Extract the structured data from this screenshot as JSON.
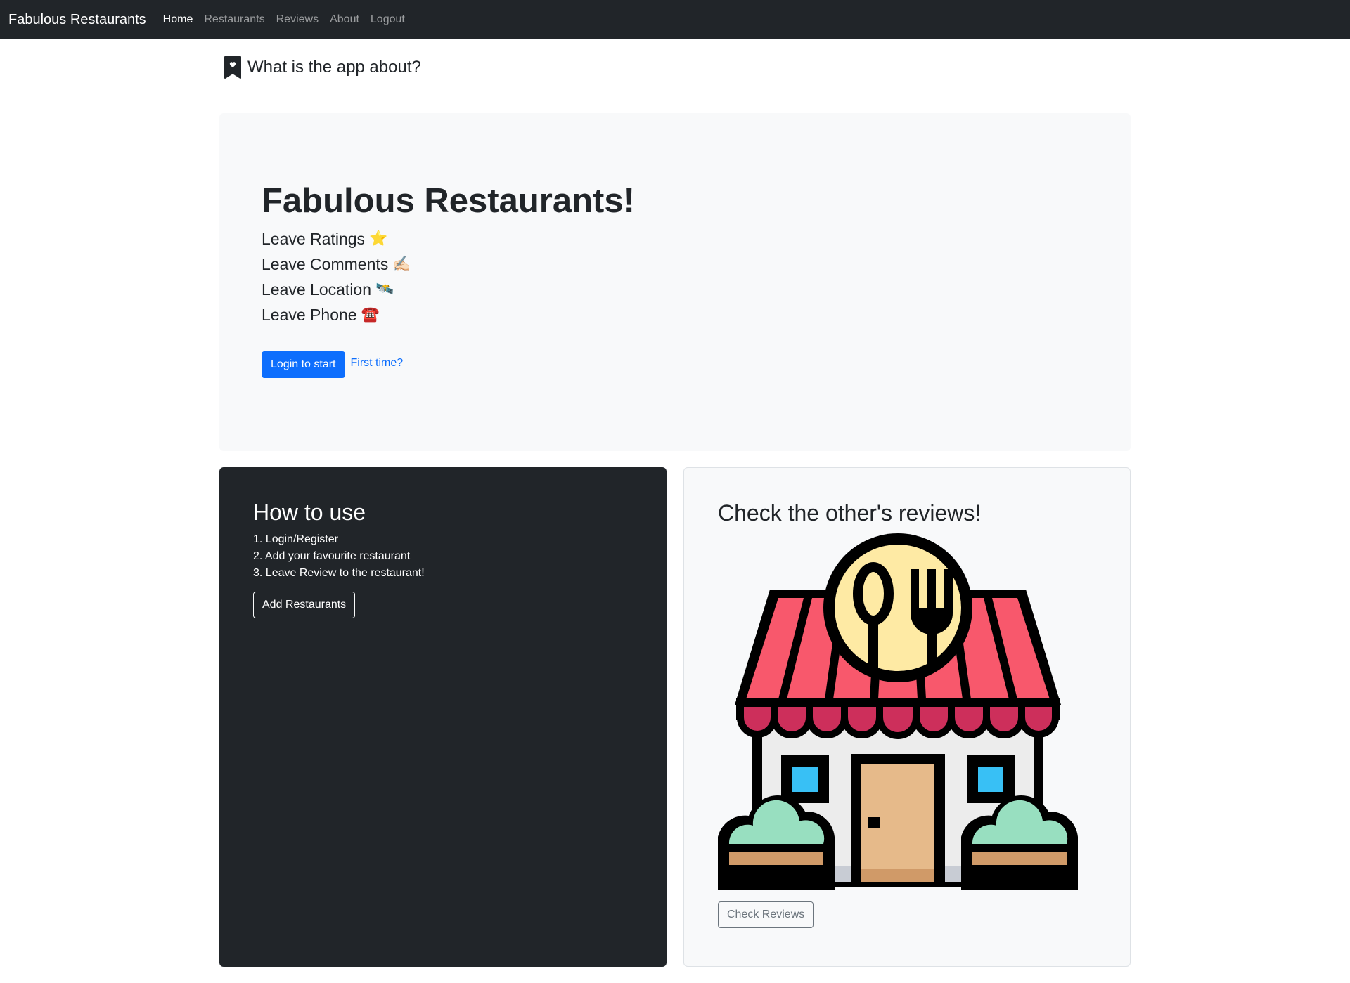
{
  "navbar": {
    "brand": "Fabulous Restaurants",
    "links": [
      {
        "label": "Home",
        "active": true
      },
      {
        "label": "Restaurants",
        "active": false
      },
      {
        "label": "Reviews",
        "active": false
      },
      {
        "label": "About",
        "active": false
      },
      {
        "label": "Logout",
        "active": false
      }
    ]
  },
  "header": {
    "icon": "bookmark-heart-icon",
    "title": "What is the app about?"
  },
  "hero": {
    "title": "Fabulous Restaurants!",
    "features": [
      {
        "label": "Leave Ratings",
        "emoji": "⭐"
      },
      {
        "label": "Leave Comments",
        "emoji": "✍🏻"
      },
      {
        "label": "Leave Location",
        "emoji": "🛰️"
      },
      {
        "label": "Leave Phone",
        "emoji": "☎️"
      }
    ],
    "login_button": "Login to start",
    "first_time_link": "First time?"
  },
  "how_to_use": {
    "title": "How to use",
    "steps": [
      "1. Login/Register",
      "2. Add your favourite restaurant",
      "3. Leave Review to the restaurant!"
    ],
    "button": "Add Restaurants"
  },
  "reviews_card": {
    "title": "Check the other's reviews!",
    "illustration": "restaurant-building-icon",
    "button": "Check Reviews"
  },
  "colors": {
    "navbar_bg": "#212529",
    "primary": "#0d6efd",
    "awning_red": "#f8586c",
    "awning_dark_red": "#cd2f5b",
    "sign_yellow": "#feeaa4",
    "window_blue": "#38c0f5",
    "door_tan": "#e6ba8a",
    "bush_green": "#98dfc0"
  }
}
